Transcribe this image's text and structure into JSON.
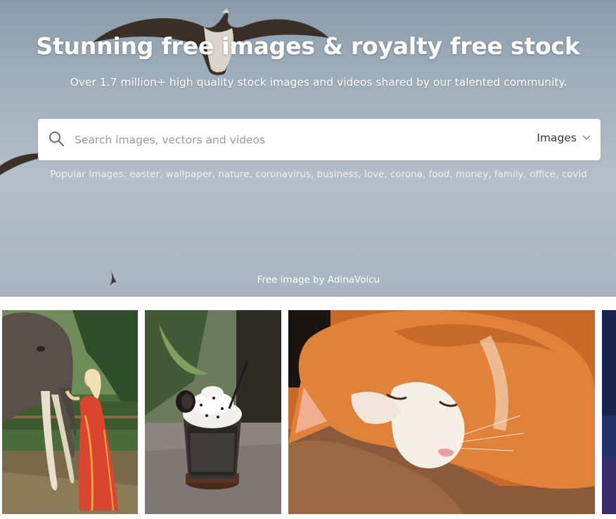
{
  "hero": {
    "title": "Stunning free images & royalty free stock",
    "subtitle": "Over 1.7 million+ high quality stock images and videos shared by our talented community.",
    "credit": "Free image by AdinaVoicu"
  },
  "search": {
    "placeholder": "Search images, vectors and videos",
    "type_selected": "Images"
  },
  "popular": {
    "label": "Popular Images:",
    "tags": [
      "easter",
      "wallpaper",
      "nature",
      "coronavirus",
      "business",
      "love",
      "corona",
      "food",
      "money",
      "family",
      "office",
      "covid"
    ]
  },
  "gallery": {
    "items": [
      {
        "name": "elephant-woman-photo"
      },
      {
        "name": "oreo-drink-photo"
      },
      {
        "name": "sleeping-cat-photo"
      },
      {
        "name": "night-photo"
      }
    ]
  }
}
